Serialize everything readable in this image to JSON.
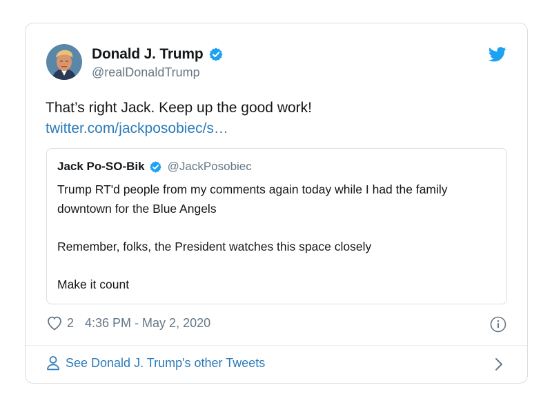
{
  "tweet": {
    "author": {
      "display_name": "Donald J. Trump",
      "handle": "@realDonaldTrump",
      "verified": true
    },
    "text": "That’s right Jack. Keep up the good work!",
    "link_text": "twitter.com/jackposobiec/s…",
    "quoted_tweet": {
      "display_name": "Jack Po-SO-Bik",
      "handle": "@JackPosobiec",
      "verified": true,
      "paragraphs": [
        "Trump RT'd people from my comments again today while I had the family downtown for the Blue Angels",
        "Remember, folks, the President watches this space closely",
        "Make it count"
      ]
    },
    "likes": "2",
    "timestamp": "4:36 PM - May 2, 2020",
    "footer_link": "See Donald J. Trump's other Tweets"
  },
  "colors": {
    "link_blue": "#2b7bb9",
    "verified_blue": "#1da1f2",
    "muted_gray": "#657786",
    "border": "#d8dee3"
  },
  "icons": {
    "brand": "twitter-bird-icon",
    "verified": "verified-badge-icon",
    "like": "heart-icon",
    "info": "info-icon",
    "profile": "person-icon",
    "chevron": "chevron-right-icon"
  }
}
